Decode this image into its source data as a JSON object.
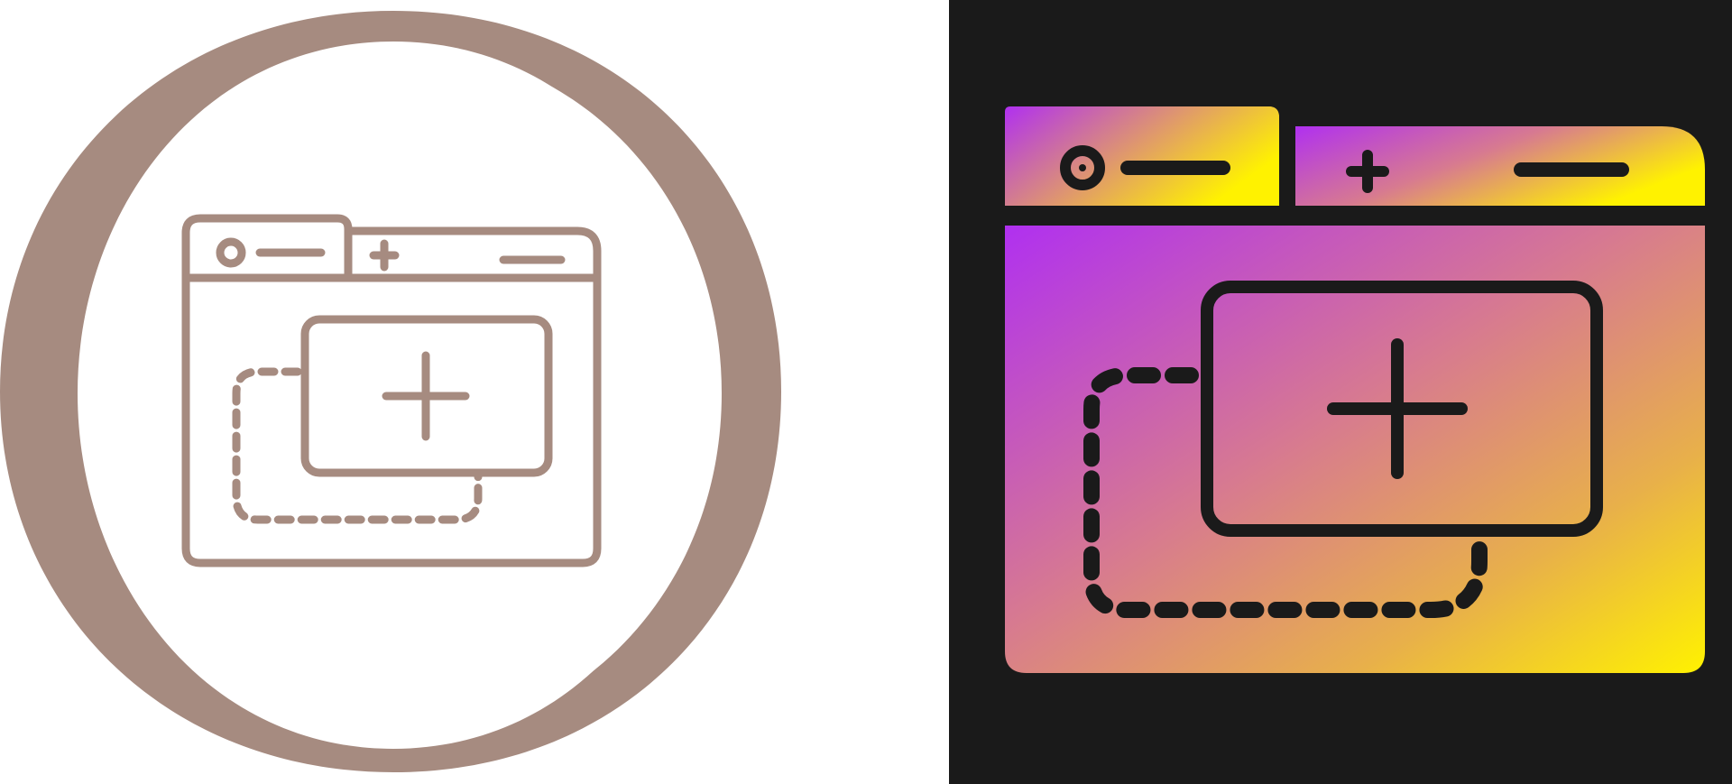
{
  "icons": [
    {
      "name": "new-tab-browser-icon",
      "style": "outline",
      "stroke_color": "#A68B80",
      "background": "#FFFFFF"
    },
    {
      "name": "new-tab-browser-icon",
      "style": "gradient-glyph",
      "stroke_color": "#1A1A1A",
      "background": "#1A1A1A",
      "gradient_colors": [
        "#B030F0",
        "#D77A90",
        "#E8B04A",
        "#FFF200"
      ]
    }
  ]
}
